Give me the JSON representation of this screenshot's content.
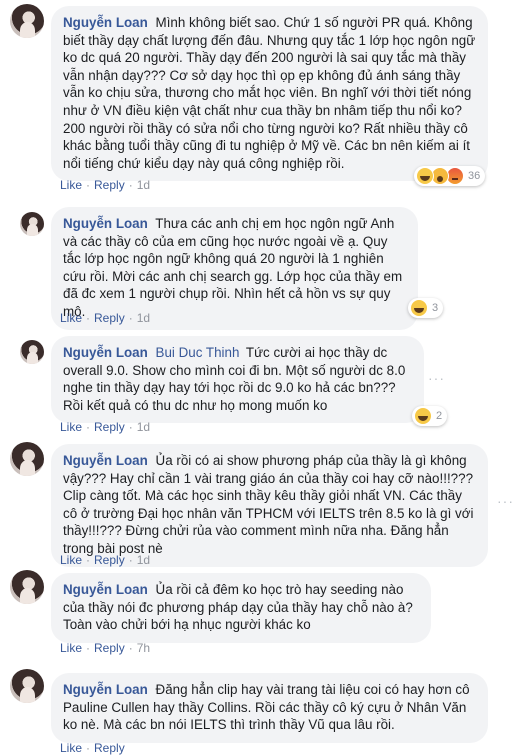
{
  "comments": [
    {
      "author": "Nguyễn Loan",
      "text": "Mình không biết sao. Chứ 1 số người PR quá. Không biết thầy dạy chất lượng đến đâu. Nhưng quy tắc 1 lớp học ngôn ngữ ko dc quá 20 người. Thầy dạy đến 200 người là sai quy tắc mà thầy vẫn nhận dạy??? Cơ sở dạy học thì ọp ẹp không đủ ánh sáng thầy vẫn ko chịu sửa, thương cho mắt học viên. Bn nghĩ với thời tiết nóng như ở VN điều kiện vật chất như cua thầy bn nhâm tiếp thu nổi ko? 200 người rồi thầy có sửa nổi cho từng người ko? Rất nhiều thầy cô khác bằng tuổi thầy cũng đi tu nghiệp ở Mỹ về. Các bn nên kiếm ai ít nổi tiếng chứ kiểu dạy này quá công nghiệp rồi.",
      "like": "Like",
      "reply": "Reply",
      "time": "1d",
      "reactions": [
        "haha",
        "wow",
        "angry"
      ],
      "reaction_count": "36"
    },
    {
      "author": "Nguyễn Loan",
      "text": "Thưa các anh chị em học ngôn ngữ Anh và các thầy cô của em cũng học nước ngoài về ạ. Quy tắc lớp học ngôn ngữ không quá 20 người là 1 nghiên cứu rồi. Mời các anh chị search gg. Lớp học của thầy em đã đc xem 1 người chụp rồi. Nhìn hết cả hồn vs sự quy mô.",
      "like": "Like",
      "reply": "Reply",
      "time": "1d",
      "reactions": [
        "haha"
      ],
      "reaction_count": "3"
    },
    {
      "author": "Nguyễn Loan",
      "mention": "Bui Duc Thinh",
      "text": "Tức cười ai học thầy dc overall 9.0. Show cho mình coi đi bn. Một số người dc 8.0 nghe tin thầy dạy hay tới học rồi dc 9.0 ko hả các bn??? Rồi kết quả có thu dc như họ mong muốn ko",
      "like": "Like",
      "reply": "Reply",
      "time": "1d",
      "reactions": [
        "haha"
      ],
      "reaction_count": "2",
      "more": "···"
    },
    {
      "author": "Nguyễn Loan",
      "text": "Ủa rồi có ai show phương pháp của thầy là gì không vậy??? Hay chỉ cần 1 vài trang giáo án của thầy coi hay cỡ nào!!!??? Clip càng tốt. Mà các học sinh thầy kêu thầy giỏi nhất VN. Các thầy cô ở trường Đại học nhân văn TPHCM với IELTS trên 8.5 ko là gì với thầy!!!??? Đừng chửi rủa vào comment mình nữa nha. Đăng hẳn trong bài post nè",
      "like": "Like",
      "reply": "Reply",
      "time": "1d",
      "more": "···"
    },
    {
      "author": "Nguyễn Loan",
      "text": "Ủa rồi cả đêm ko học trò hay seeding nào của thầy nói đc phương pháp dạy của thầy hay chỗ nào à? Toàn vào chửi bới hạ nhục người khác ko",
      "like": "Like",
      "reply": "Reply",
      "time": "7h"
    },
    {
      "author": "Nguyễn Loan",
      "text": "Đăng hẳn clip hay vài trang tài liệu coi có hay hơn cô Pauline Cullen hay thầy Collins. Rồi các thầy cô ký cựu ở Nhân Văn ko nè. Mà các bn nói IELTS thì trình thầy Vũ qua lâu rồi.",
      "like": "Like",
      "reply": "Reply"
    }
  ],
  "colors": {
    "link": "#385898",
    "bubble": "#f2f3f5",
    "meta": "#90949c"
  }
}
